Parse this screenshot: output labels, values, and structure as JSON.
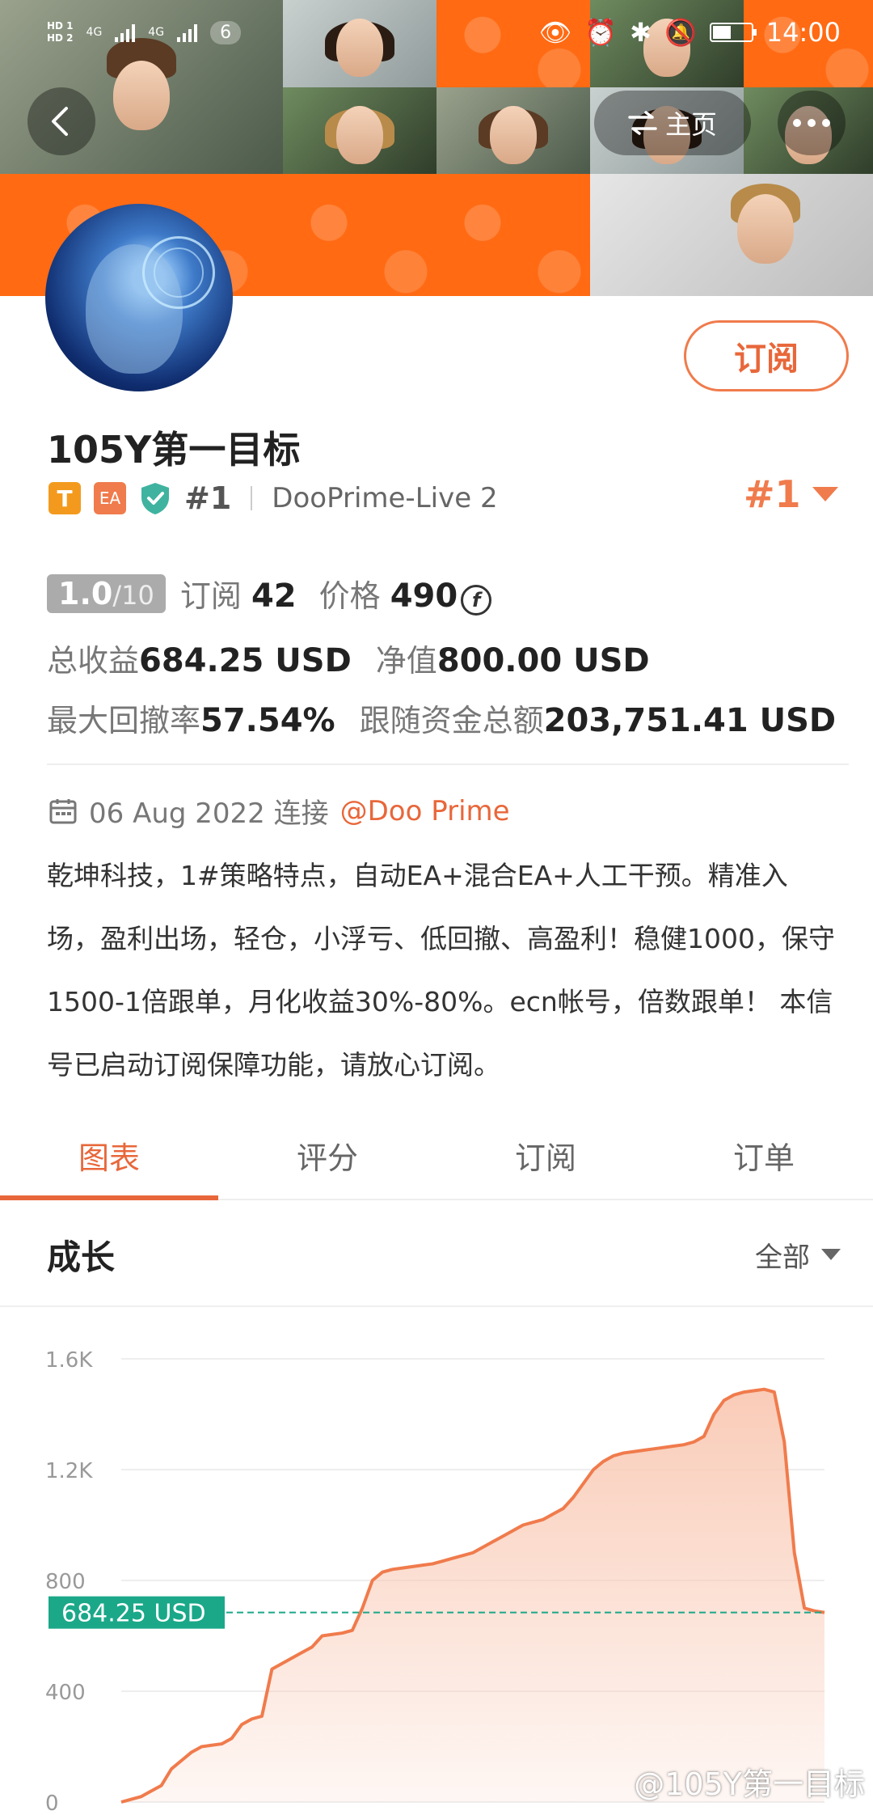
{
  "status_bar": {
    "hd_top": "HD 1",
    "hd_bottom": "HD 2",
    "net1": "4G",
    "net2": "4G",
    "notifications": "6",
    "time": "14:00"
  },
  "header": {
    "home_label": "主页"
  },
  "profile": {
    "subscribe_label": "订阅",
    "name": "105Y第一目标",
    "tag_t": "T",
    "tag_ea": "EA",
    "rank": "#1",
    "server": "DooPrime-Live 2",
    "rank_right": "#1"
  },
  "stats": {
    "score_main": "1.0",
    "score_total": "/10",
    "subs_label": "订阅",
    "subs_value": "42",
    "price_label": "价格",
    "price_value": "490",
    "coin_symbol": "f",
    "profit_label": "总收益",
    "profit_value": "684.25 USD",
    "equity_label": "净值",
    "equity_value": "800.00 USD",
    "drawdown_label": "最大回撤率",
    "drawdown_value": "57.54%",
    "follow_label": "跟随资金总额",
    "follow_value": "203,751.41 USD"
  },
  "info": {
    "date_text": "06 Aug 2022 连接",
    "broker": "@Doo Prime",
    "description": "乾坤科技，1#策略特点，自动EA+混合EA+人工干预。精准入场，盈利出场，轻仓，小浮亏、低回撤、高盈利！稳健1000，保守1500-1倍跟单，月化收益30%-80%。ecn帐号，倍数跟单！ 本信号已启动订阅保障功能，请放心订阅。"
  },
  "tabs": [
    {
      "label": "图表",
      "active": true
    },
    {
      "label": "评分",
      "active": false
    },
    {
      "label": "订阅",
      "active": false
    },
    {
      "label": "订单",
      "active": false
    }
  ],
  "growth": {
    "title": "成长",
    "filter": "全部"
  },
  "chart_data": {
    "type": "area",
    "yticks": [
      "1.6K",
      "1.2K",
      "800",
      "400",
      "0"
    ],
    "ylim": [
      0,
      1600
    ],
    "current_label": "684.25 USD",
    "current_value": 684.25,
    "x": [
      0,
      1,
      2,
      3,
      4,
      5,
      6,
      7,
      8,
      9,
      10,
      11,
      12,
      13,
      14,
      15,
      16,
      17,
      18,
      19,
      20,
      21,
      22,
      23,
      24,
      25,
      26,
      27,
      28,
      29,
      30,
      31,
      32,
      33,
      34,
      35,
      36,
      37,
      38,
      39,
      40,
      41,
      42,
      43,
      44,
      45,
      46,
      47,
      48,
      49,
      50,
      51,
      52,
      53,
      54,
      55,
      56,
      57,
      58,
      59,
      60,
      61,
      62,
      63,
      64,
      65,
      66,
      67,
      68,
      69,
      70
    ],
    "values": [
      0,
      10,
      20,
      40,
      60,
      120,
      150,
      180,
      200,
      205,
      210,
      230,
      280,
      300,
      310,
      480,
      500,
      520,
      540,
      560,
      600,
      605,
      610,
      620,
      700,
      800,
      830,
      840,
      845,
      850,
      855,
      860,
      870,
      880,
      890,
      900,
      920,
      940,
      960,
      980,
      1000,
      1010,
      1020,
      1040,
      1060,
      1100,
      1150,
      1200,
      1230,
      1250,
      1260,
      1265,
      1270,
      1275,
      1280,
      1285,
      1290,
      1300,
      1320,
      1400,
      1450,
      1470,
      1480,
      1485,
      1490,
      1480,
      1300,
      900,
      700,
      690,
      684.25
    ],
    "grid": true,
    "line_color": "#f07b4c",
    "fill_color": "#f9c9b4",
    "marker_color": "#1aa889"
  },
  "watermark": "@105Y第一目标"
}
